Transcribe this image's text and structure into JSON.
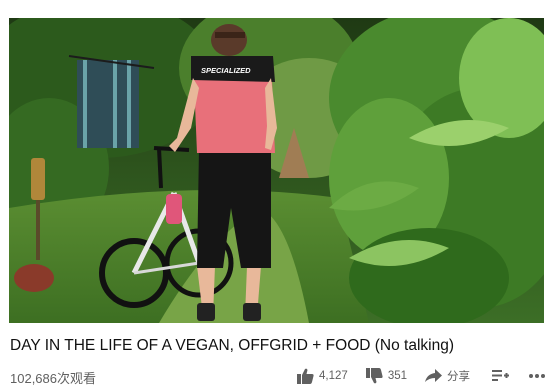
{
  "video": {
    "title": "DAY IN THE LIFE OF A VEGAN, OFFGRID + FOOD (No talking)",
    "views": "102,686次观看",
    "jersey_text": "SPECIALIZED"
  },
  "actions": {
    "like_count": "4,127",
    "dislike_count": "351",
    "share_label": "分享"
  },
  "colors": {
    "text_primary": "#111111",
    "text_secondary": "#606060",
    "foliage": "#3f7a2a",
    "jersey": "#e8707a"
  }
}
